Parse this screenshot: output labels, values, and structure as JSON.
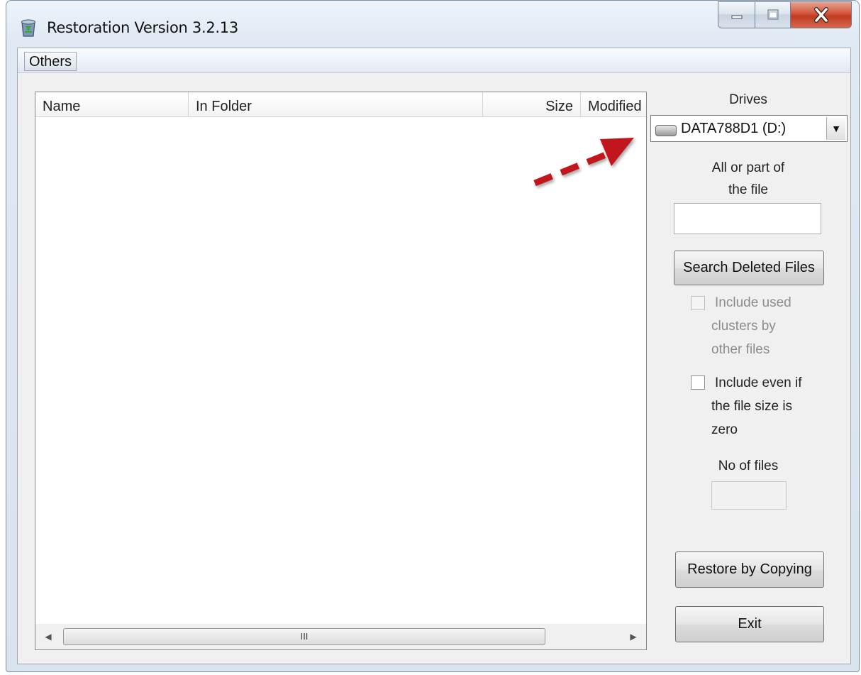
{
  "window": {
    "title": "Restoration Version 3.2.13",
    "icons": {
      "app": "recycle-bin-icon",
      "minimize": "minimize-icon",
      "maximize": "maximize-icon",
      "close": "close-icon"
    }
  },
  "menu": {
    "items": [
      "Others"
    ]
  },
  "file_list": {
    "columns": [
      "Name",
      "In Folder",
      "Size",
      "Modified"
    ],
    "rows": [],
    "scrollbar": {
      "thumb_glyph": "III"
    }
  },
  "side_panel": {
    "drives_label": "Drives",
    "drive_selected": "DATA788D1 (D:)",
    "search_label_line1": "All or part of",
    "search_label_line2": "the file",
    "search_value": "",
    "search_button": "Search Deleted Files",
    "include_used_lines": [
      "Include used",
      "clusters by",
      "other files"
    ],
    "include_used_checked": false,
    "include_used_enabled": false,
    "include_zero_lines": [
      "Include even if",
      "the file size is",
      "zero"
    ],
    "include_zero_checked": false,
    "no_of_files_label": "No of files",
    "no_of_files_value": "",
    "restore_button": "Restore by Copying",
    "exit_button": "Exit"
  },
  "annotation": {
    "color": "#c0191c"
  }
}
